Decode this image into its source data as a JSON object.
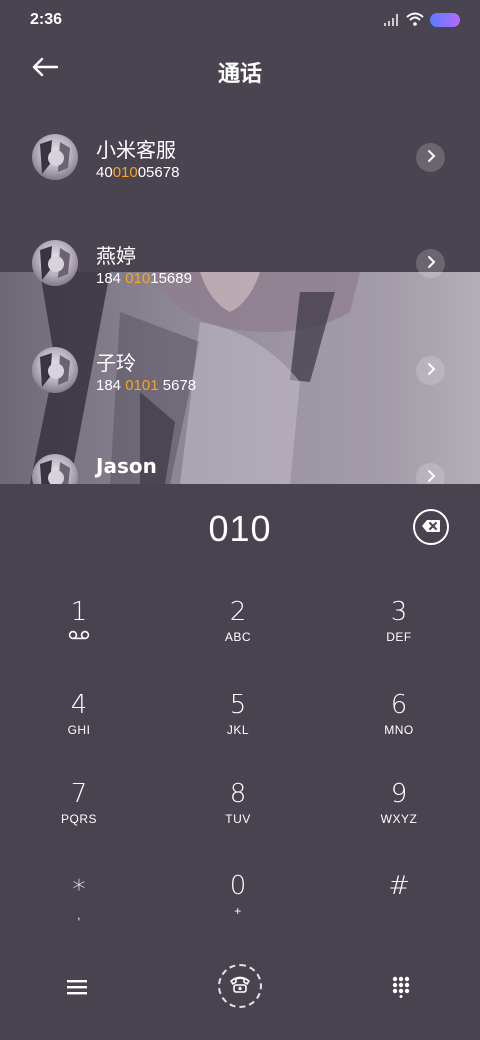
{
  "status": {
    "time": "2:36",
    "icons": [
      "signal-icon",
      "wifi-icon",
      "battery-icon"
    ],
    "accent": "#6f73ff"
  },
  "header": {
    "back_icon": "arrow-left-icon",
    "title": "通话"
  },
  "contacts": [
    {
      "name": "小米客服",
      "num_pre": "40",
      "num_hl": "010",
      "num_post": "05678"
    },
    {
      "name": "燕婷",
      "num_pre": "184 ",
      "num_hl": "010",
      "num_post": "15689"
    },
    {
      "name": "子玲",
      "num_pre": "184 ",
      "num_hl": "0101",
      "num_post": " 5678"
    },
    {
      "name": "Jason",
      "num_pre": "",
      "num_hl": "",
      "num_post": ""
    }
  ],
  "highlight_color": "#f5a623",
  "dialer": {
    "display": "010",
    "backspace_icon": "backspace-icon",
    "keys": [
      {
        "digit": "1",
        "letters": ""
      },
      {
        "digit": "2",
        "letters": "ABC"
      },
      {
        "digit": "3",
        "letters": "DEF"
      },
      {
        "digit": "4",
        "letters": "GHI"
      },
      {
        "digit": "5",
        "letters": "JKL"
      },
      {
        "digit": "6",
        "letters": "MNO"
      },
      {
        "digit": "7",
        "letters": "PQRS"
      },
      {
        "digit": "8",
        "letters": "TUV"
      },
      {
        "digit": "9",
        "letters": "WXYZ"
      },
      {
        "digit": "*",
        "letters": ","
      },
      {
        "digit": "0",
        "letters": "+"
      },
      {
        "digit": "#",
        "letters": ""
      }
    ]
  },
  "bottom_bar": {
    "menu_icon": "menu-icon",
    "call_icon": "phone-call-icon",
    "keypad_icon": "keypad-icon"
  }
}
